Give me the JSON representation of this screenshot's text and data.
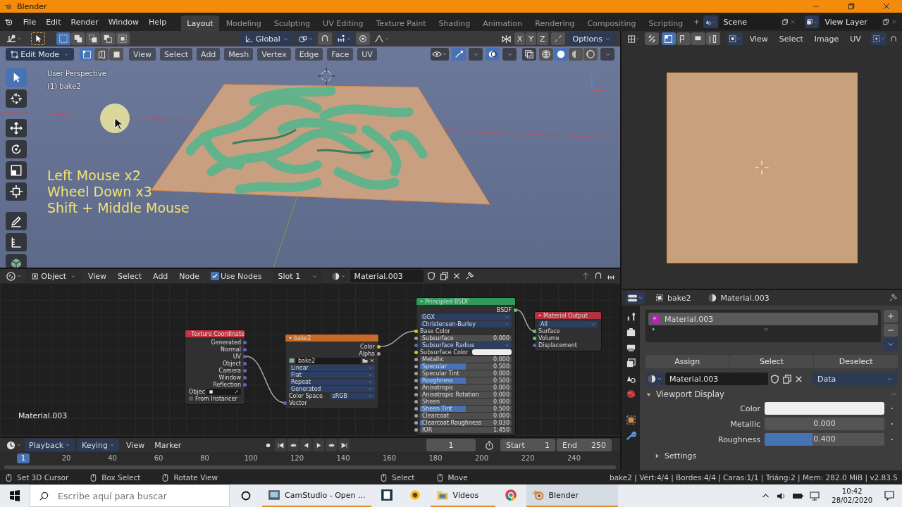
{
  "window": {
    "title": "Blender"
  },
  "topbar": {
    "menus": [
      "File",
      "Edit",
      "Render",
      "Window",
      "Help"
    ],
    "workspaces": [
      {
        "label": "Layout",
        "selected": true
      },
      {
        "label": "Modeling",
        "selected": false
      },
      {
        "label": "Sculpting",
        "selected": false
      },
      {
        "label": "UV Editing",
        "selected": false
      },
      {
        "label": "Texture Paint",
        "selected": false
      },
      {
        "label": "Shading",
        "selected": false
      },
      {
        "label": "Animation",
        "selected": false
      },
      {
        "label": "Rendering",
        "selected": false
      },
      {
        "label": "Compositing",
        "selected": false
      },
      {
        "label": "Scripting",
        "selected": false
      }
    ],
    "scene": "Scene",
    "view_layer": "View Layer"
  },
  "viewport": {
    "box_modes": [
      {
        "selected": true
      },
      {
        "selected": false
      },
      {
        "selected": false
      },
      {
        "selected": false
      },
      {
        "selected": false
      }
    ],
    "orientation": "Global",
    "axes": [
      {
        "label": "X",
        "on": false
      },
      {
        "label": "Y",
        "on": false
      },
      {
        "label": "Z",
        "on": false
      }
    ],
    "options": "Options",
    "mode": "Edit Mode",
    "select_modes": [
      {
        "selected": true
      },
      {
        "selected": false
      },
      {
        "selected": false
      }
    ],
    "menus": [
      "View",
      "Select",
      "Add",
      "Mesh",
      "Vertex",
      "Edge",
      "Face",
      "UV"
    ],
    "shading": [
      {
        "selected": false
      },
      {
        "selected": true
      },
      {
        "selected": false
      },
      {
        "selected": false
      }
    ],
    "tools": [
      {
        "kind": "select",
        "selected": true
      },
      {
        "kind": "cursor",
        "selected": false
      },
      {
        "kind": "move",
        "selected": false
      },
      {
        "kind": "rotate",
        "selected": false
      },
      {
        "kind": "scale",
        "selected": false
      },
      {
        "kind": "transform",
        "selected": false
      },
      {
        "kind": "annotate",
        "selected": false
      },
      {
        "kind": "measure",
        "selected": false
      },
      {
        "kind": "add-cube",
        "selected": false
      }
    ],
    "info": [
      "User Perspective",
      "(1) bake2"
    ],
    "keys": [
      "Left Mouse x2",
      "Wheel Down x3",
      "Shift + Middle Mouse"
    ]
  },
  "image_editor": {
    "menus": [
      "View",
      "Select",
      "Image",
      "UV"
    ]
  },
  "node_editor": {
    "object": "Object",
    "menus": [
      "View",
      "Select",
      "Add",
      "Node"
    ],
    "use_nodes": {
      "label": "Use Nodes",
      "checked": true
    },
    "slot": "Slot 1",
    "material": "Material.003",
    "label": "Material.003",
    "nodes": [
      {
        "title": "Texture Coordinate",
        "kind": "input",
        "rows": [
          {
            "kind": "output",
            "label": "Generated",
            "color": "#6363c7"
          },
          {
            "kind": "output",
            "label": "Normal",
            "color": "#6363c7"
          },
          {
            "kind": "output",
            "label": "UV",
            "color": "#6363c7",
            "linked": true
          },
          {
            "kind": "output",
            "label": "Object",
            "color": "#6363c7"
          },
          {
            "kind": "output",
            "label": "Camera",
            "color": "#6363c7"
          },
          {
            "kind": "output",
            "label": "Window",
            "color": "#6363c7"
          },
          {
            "kind": "output",
            "label": "Reflection",
            "color": "#6363c7"
          },
          {
            "kind": "object",
            "label": "Objec"
          },
          {
            "kind": "checkbox",
            "label": "From Instancer",
            "checked": false
          }
        ]
      },
      {
        "title": "bake2",
        "kind": "texture",
        "rows": [
          {
            "kind": "output",
            "label": "Color",
            "color": "#c7c729",
            "linked": true
          },
          {
            "kind": "output",
            "label": "Alpha",
            "color": "#a1a1a1"
          },
          {
            "kind": "image",
            "value": "bake2"
          },
          {
            "kind": "dropdown",
            "value": "Linear"
          },
          {
            "kind": "dropdown",
            "value": "Flat"
          },
          {
            "kind": "dropdown",
            "value": "Repeat"
          },
          {
            "kind": "dropdown",
            "value": "Generated"
          },
          {
            "kind": "labeled-dropdown",
            "label": "Color Space",
            "value": "sRGB"
          },
          {
            "kind": "input",
            "label": "Vector",
            "color": "#6363c7",
            "linked": true
          }
        ]
      },
      {
        "title": "Principled BSDF",
        "kind": "shader",
        "rows": [
          {
            "kind": "output",
            "label": "BSDF",
            "color": "#63c763",
            "linked": true
          },
          {
            "kind": "dropdown",
            "value": "GGX"
          },
          {
            "kind": "dropdown",
            "value": "Christensen-Burley"
          },
          {
            "kind": "input",
            "label": "Base Color",
            "color": "#c7c729",
            "linked": true
          },
          {
            "kind": "slider",
            "label": "Subsurface",
            "value": "0.000",
            "level": 0,
            "color": "#a1a1a1"
          },
          {
            "kind": "dropdown",
            "value": "Subsurface Radius",
            "color": "#6363c7"
          },
          {
            "kind": "color",
            "label": "Subsurface Color",
            "swatch": {
              "color": "#eeeeee"
            },
            "color": "#c7c729"
          },
          {
            "kind": "slider",
            "label": "Metallic",
            "value": "0.000",
            "level": 0,
            "color": "#a1a1a1"
          },
          {
            "kind": "slider",
            "label": "Specular",
            "value": "0.500",
            "level": 0.5,
            "color": "#a1a1a1"
          },
          {
            "kind": "slider",
            "label": "Specular Tint",
            "value": "0.000",
            "level": 0,
            "color": "#a1a1a1"
          },
          {
            "kind": "slider",
            "label": "Roughness",
            "value": "0.500",
            "level": 0.5,
            "color": "#a1a1a1"
          },
          {
            "kind": "slider",
            "label": "Anisotropic",
            "value": "0.000",
            "level": 0,
            "color": "#a1a1a1"
          },
          {
            "kind": "slider",
            "label": "Anisotropic Rotation",
            "value": "0.000",
            "level": 0,
            "color": "#a1a1a1"
          },
          {
            "kind": "slider",
            "label": "Sheen",
            "value": "0.000",
            "level": 0,
            "color": "#a1a1a1"
          },
          {
            "kind": "slider",
            "label": "Sheen Tint",
            "value": "0.500",
            "level": 0.5,
            "color": "#a1a1a1"
          },
          {
            "kind": "slider",
            "label": "Clearcoat",
            "value": "0.000",
            "level": 0,
            "color": "#a1a1a1"
          },
          {
            "kind": "slider",
            "label": "Clearcoat Roughness",
            "value": "0.030",
            "level": 0.03,
            "color": "#a1a1a1"
          },
          {
            "kind": "slider",
            "label": "IOR",
            "value": "1.450",
            "level": 0,
            "color": "#a1a1a1"
          }
        ]
      },
      {
        "title": "Material Output",
        "kind": "output",
        "rows": [
          {
            "kind": "dropdown",
            "value": "All"
          },
          {
            "kind": "input",
            "label": "Surface",
            "color": "#63c763",
            "linked": true
          },
          {
            "kind": "input",
            "label": "Volume",
            "color": "#63c763"
          },
          {
            "kind": "input",
            "label": "Displacement",
            "color": "#6363c7"
          }
        ]
      }
    ]
  },
  "timeline": {
    "menus": [
      {
        "label": "Playback",
        "dropdown": true
      },
      {
        "label": "Keying",
        "dropdown": true
      },
      {
        "label": "View",
        "dropdown": false
      },
      {
        "label": "Marker",
        "dropdown": false
      }
    ],
    "frame": "1",
    "start_label": "Start",
    "start": "1",
    "end_label": "End",
    "end": "250",
    "current": "1",
    "ticks": [
      "20",
      "40",
      "60",
      "80",
      "100",
      "120",
      "140",
      "160",
      "180",
      "200",
      "220",
      "240"
    ]
  },
  "properties": {
    "object": "bake2",
    "material": "Material.003",
    "slots": [
      {
        "name": "Material.003",
        "selected": true
      }
    ],
    "buttons": [
      "Assign",
      "Select",
      "Deselect"
    ],
    "material_field": "Material.003",
    "link": "Data",
    "panel": {
      "title": "Viewport Display",
      "expanded": true
    },
    "fields": [
      {
        "kind": "color",
        "label": "Color",
        "color": "#efefef"
      },
      {
        "kind": "slider",
        "label": "Metallic",
        "value": "0.000",
        "level": 0
      },
      {
        "kind": "slider",
        "label": "Roughness",
        "value": "0.400",
        "level": 0.4
      }
    ],
    "subpanel": {
      "title": "Settings",
      "expanded": false
    }
  },
  "status_bar": {
    "hint_groups": [
      [
        {
          "label": "Set 3D Cursor"
        },
        {
          "label": "Box Select"
        },
        {
          "label": "Rotate View"
        }
      ],
      [
        {
          "label": "Select"
        },
        {
          "label": "Move"
        }
      ]
    ],
    "stats": "bake2 | Vért:4/4 | Bordes:4/4 | Caras:1/1 | Triáng:2 | Mem: 282.0 MiB | v2.83.5"
  },
  "taskbar": {
    "search_placeholder": "Escribe aquí para buscar",
    "apps": [
      {
        "kind": "camstudio",
        "label": "CamStudio - Open ...",
        "open": true,
        "selected": false
      },
      {
        "kind": "cards",
        "open": false,
        "selected": false
      },
      {
        "kind": "sunflower",
        "open": false,
        "selected": false
      },
      {
        "kind": "folder",
        "label": "Vídeos",
        "open": true,
        "selected": false
      },
      {
        "kind": "chrome",
        "open": false,
        "selected": false
      },
      {
        "kind": "blender",
        "label": "Blender",
        "open": true,
        "selected": true
      }
    ],
    "time": "10:42",
    "date": "28/02/2020"
  }
}
